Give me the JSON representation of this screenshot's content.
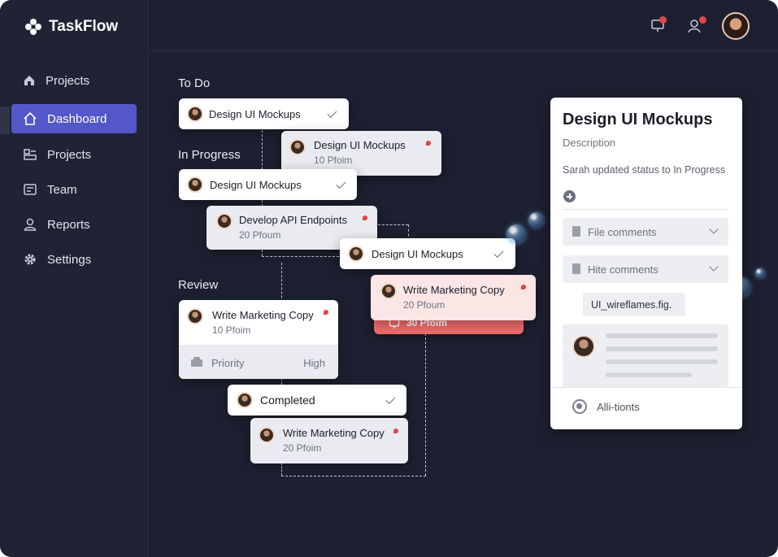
{
  "app": {
    "name": "TaskFlow"
  },
  "sidebar": {
    "items": [
      {
        "label": "Projects",
        "icon": "home-icon"
      },
      {
        "label": "Dashboard",
        "icon": "dashboard-icon",
        "active": true
      },
      {
        "label": "Projects",
        "icon": "projects-icon"
      },
      {
        "label": "Team",
        "icon": "team-icon"
      },
      {
        "label": "Reports",
        "icon": "reports-icon"
      },
      {
        "label": "Settings",
        "icon": "gear-icon"
      }
    ]
  },
  "board": {
    "columns": {
      "todo": "To Do",
      "in_progress": "In Progress",
      "review": "Review"
    },
    "cards": {
      "todo_1": {
        "title": "Design UI Mockups"
      },
      "todo_2": {
        "title": "Design UI Mockups",
        "sub": "10 Pfoim"
      },
      "inprog_1": {
        "title": "Design UI Mockups"
      },
      "inprog_2": {
        "title": "Develop API Endpoints",
        "sub": "20 Pfoum"
      },
      "inprog_3": {
        "title": "Design UI Mockups"
      },
      "inprog_4": {
        "title": "Write Marketing Copy",
        "sub": "20 Pfoum",
        "overdue": "30 Pfoim"
      },
      "review_1": {
        "title": "Write Marketing Copy",
        "sub": "10 Pfoim",
        "priority_label": "Priority",
        "priority_value": "High"
      },
      "completed": {
        "title": "Completed"
      },
      "completed_1": {
        "title": "Write Marketing Copy",
        "sub": "20 Pfoim"
      }
    }
  },
  "detail": {
    "title": "Design UI Mockups",
    "description_label": "Description",
    "status_update": "Sarah updated status to In Progress",
    "accordion_1": "File comments",
    "accordion_2": "Hite comments",
    "attachment": "UI_wireflames.fig.",
    "footer_label": "Alli-tionts"
  },
  "colors": {
    "accent": "#5457c9",
    "background": "#1d2030",
    "flag": "#e84242",
    "overdue": "#ee6b6b"
  }
}
